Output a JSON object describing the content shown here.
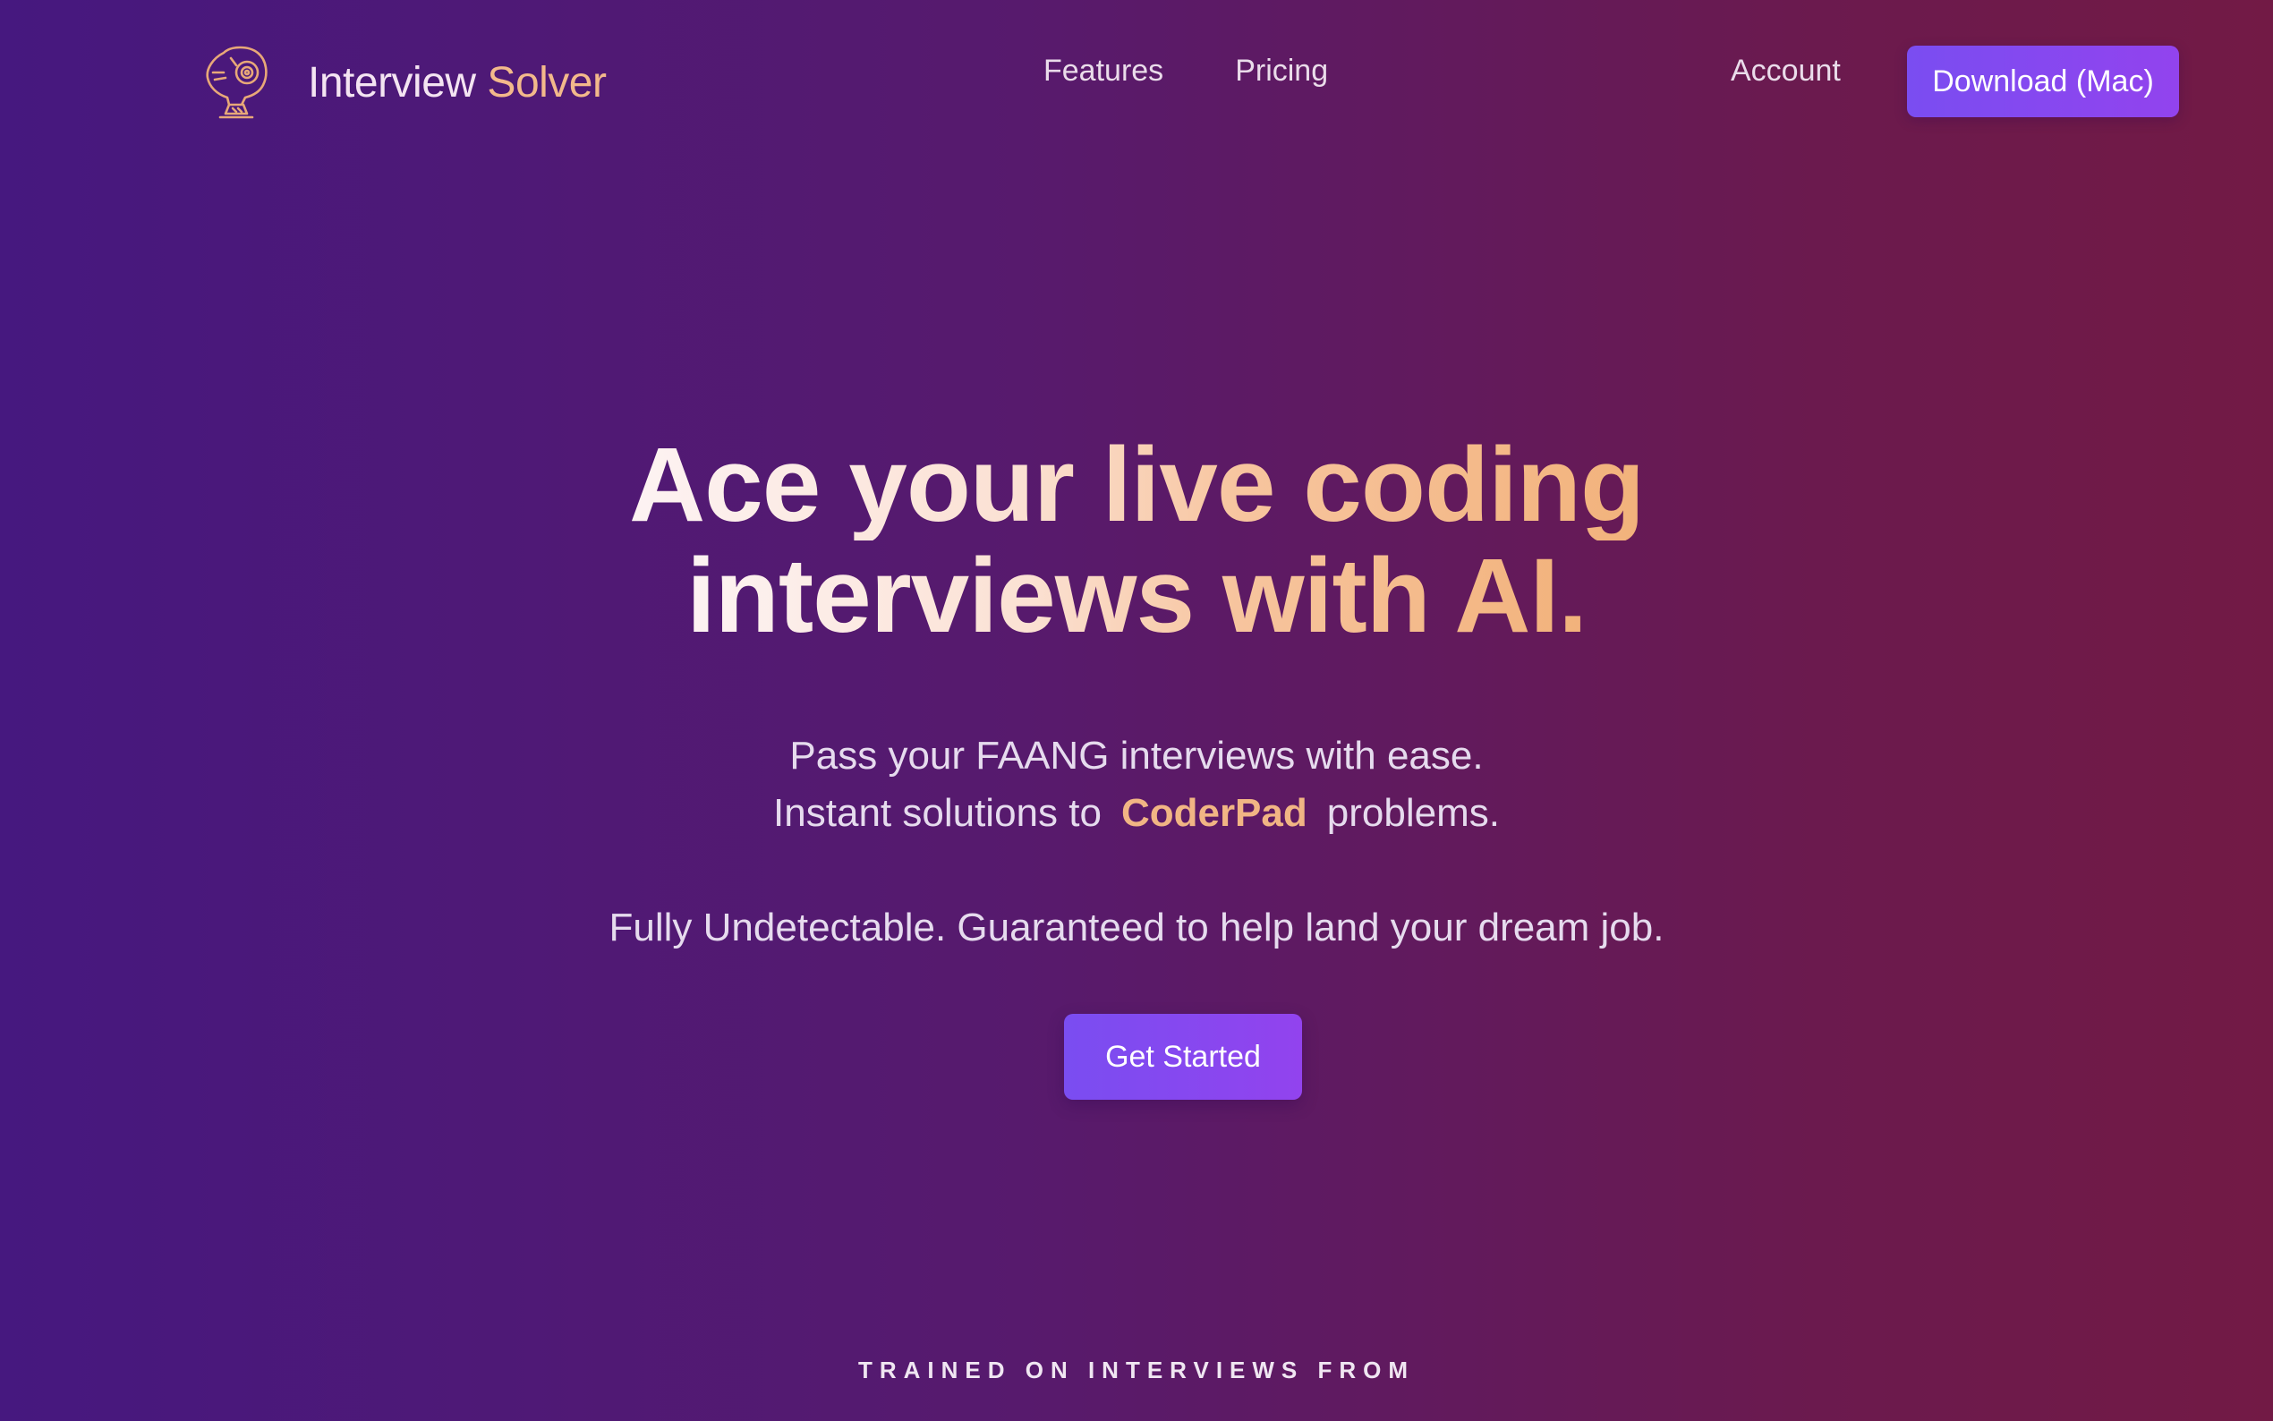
{
  "nav": {
    "brand": {
      "name_part1": "Interview",
      "name_part2": "Solver",
      "logo_icon": "robot-head-icon"
    },
    "links": [
      {
        "label": "Features"
      },
      {
        "label": "Pricing"
      }
    ],
    "account_label": "Account",
    "download_label": "Download (Mac)"
  },
  "hero": {
    "headline_line1_part1": "Ace your",
    "headline_line1_part2": "live coding",
    "headline_line2": "interviews with AI.",
    "subtitle_line1": "Pass your FAANG interviews with ease.",
    "subtitle_line2_prefix": "Instant solutions to",
    "subtitle_line2_highlight": "CoderPad",
    "subtitle_line2_suffix": "problems.",
    "tagline": "Fully Undetectable. Guaranteed to help land your dream job.",
    "cta_label": "Get Started",
    "trained_label": "TRAINED ON INTERVIEWS FROM"
  },
  "colors": {
    "background_start": "#46187f",
    "background_end": "#721a45",
    "accent_button": "#7a4df1",
    "accent_text": "#f3b98b"
  }
}
